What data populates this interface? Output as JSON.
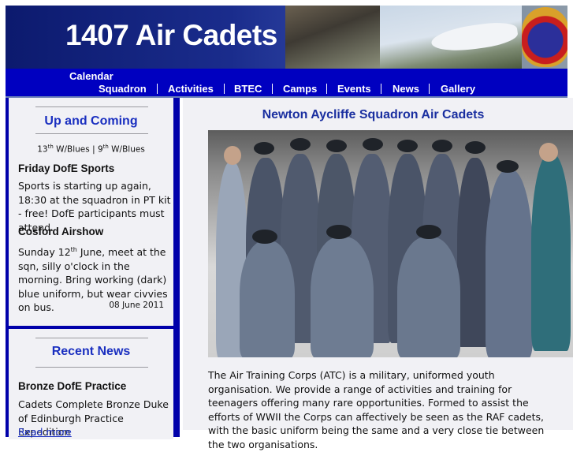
{
  "header": {
    "title": "1407 Air Cadets"
  },
  "nav": {
    "items": [
      "Calendar",
      "Squadron",
      "Activities",
      "BTEC",
      "Camps",
      "Events",
      "News",
      "Gallery"
    ]
  },
  "upcoming": {
    "title": "Up and Coming",
    "dates": {
      "d1": "13",
      "s1": "th",
      "t1": " W/Blues | ",
      "d2": "9",
      "s2": "th",
      "t2": " W/Blues"
    },
    "events": [
      {
        "title": "Friday DofE Sports",
        "text": "Sports is starting up again, 18:30 at the squadron in PT kit - free! DofE participants must attend."
      },
      {
        "title": "Cosford Airshow",
        "text_a": "Sunday 12",
        "text_sup": "th",
        "text_b": " June, meet at the sqn, silly o'clock in the morning. Bring working (dark) blue uniform, but wear civvies on bus.",
        "date": "08 June 2011"
      }
    ]
  },
  "news": {
    "title": "Recent News",
    "items": [
      {
        "title": "Bronze DofE Practice",
        "text": "Cadets Complete Bronze Duke of Edinburgh Practice Expedition",
        "link": "Read more"
      }
    ]
  },
  "main": {
    "title": "Newton Aycliffe Squadron Air Cadets",
    "intro": "The Air Training Corps (ATC) is a military, uniformed youth organisation. We provide a range of activities and training for teenagers offering many rare opportunities. Formed to assist the efforts of WWII the Corps can affectively be seen as the RAF cadets, with the basic uniform being the same and a very close tie between the two organisations."
  },
  "colors": {
    "nav": "#0000c0",
    "sidebar": "#0000aa",
    "heading": "#1a2fc0",
    "panel": "#f1f1f5"
  }
}
